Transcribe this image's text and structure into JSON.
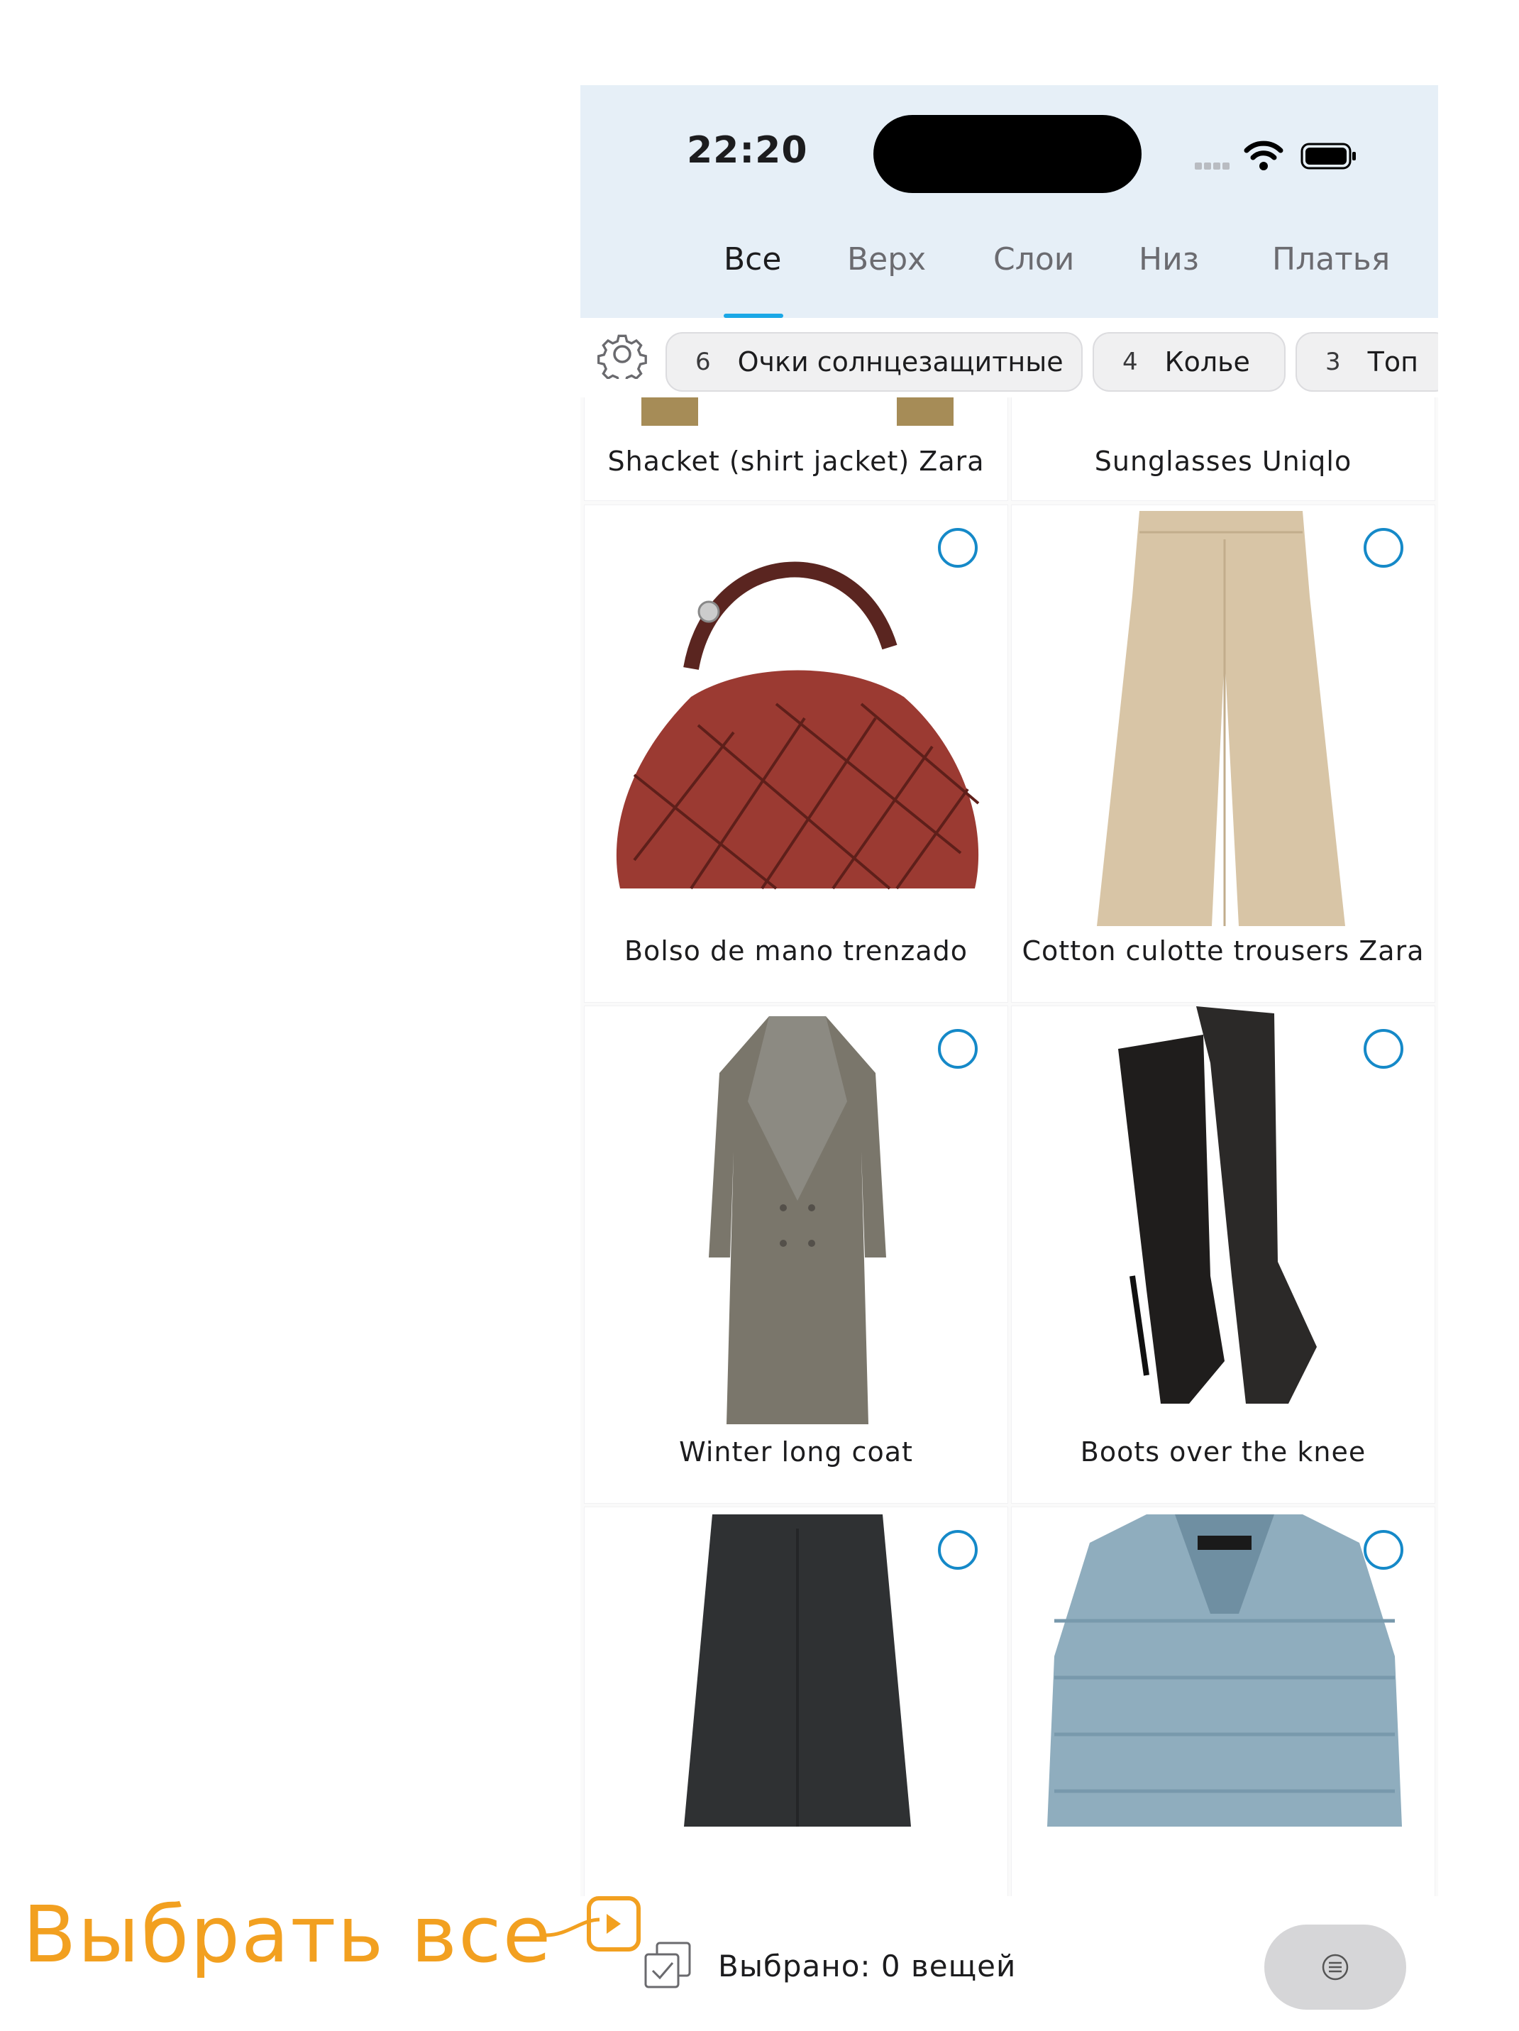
{
  "status": {
    "time": "22:20"
  },
  "tabs": [
    {
      "label": "Все",
      "active": true
    },
    {
      "label": "Верх"
    },
    {
      "label": "Слои"
    },
    {
      "label": "Низ"
    },
    {
      "label": "Платья"
    }
  ],
  "chips": [
    {
      "count": "6",
      "label": "Очки солнцезащитные"
    },
    {
      "count": "4",
      "label": "Колье"
    },
    {
      "count": "3",
      "label": "Топ"
    }
  ],
  "items": [
    {
      "title": "Shacket (shirt jacket) Zara"
    },
    {
      "title": "Sunglasses Uniqlo"
    },
    {
      "title": "Bolso de mano trenzado"
    },
    {
      "title": "Cotton culotte trousers Zara"
    },
    {
      "title": "Winter long coat"
    },
    {
      "title": "Boots over the knee"
    },
    {
      "title": ""
    },
    {
      "title": ""
    }
  ],
  "bottom": {
    "selected_text": "Выбрано: 0 вещей"
  },
  "annotation": {
    "text": "Выбрать все"
  },
  "colors": {
    "accent": "#1aa7e6",
    "radio": "#1589c8",
    "annotation": "#f2a020",
    "header_bg": "#e6eff7"
  }
}
